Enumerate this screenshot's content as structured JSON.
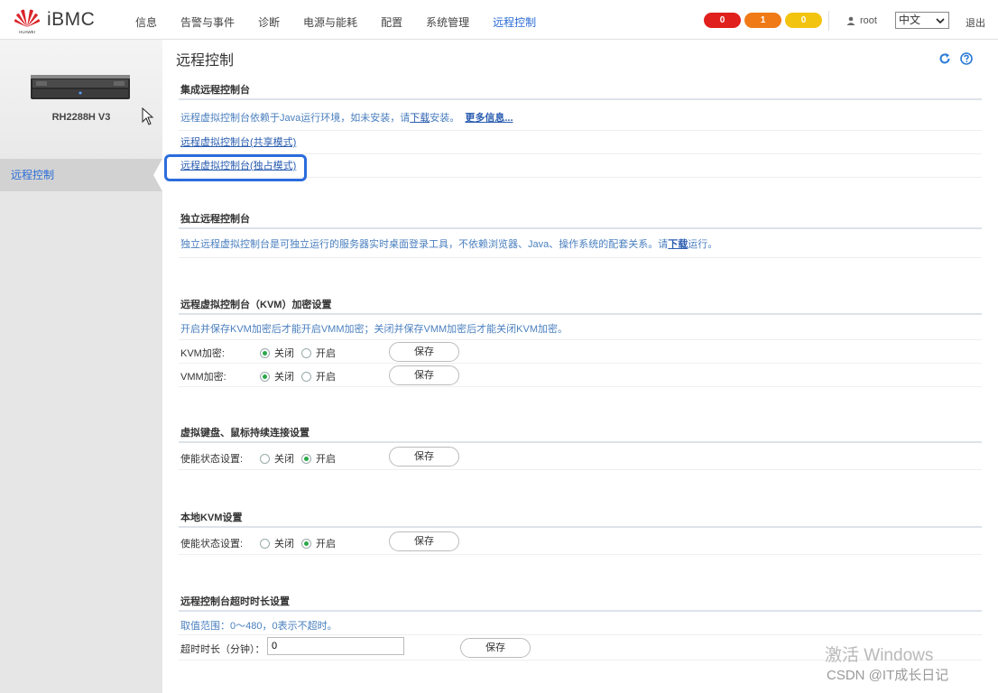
{
  "header": {
    "logo_text": "HUAWEI",
    "brand": "iBMC",
    "nav": [
      "信息",
      "告警与事件",
      "诊断",
      "电源与能耗",
      "配置",
      "系统管理",
      "远程控制"
    ],
    "active_nav": "远程控制",
    "alarms": [
      {
        "count": "0",
        "color": "#e0201d"
      },
      {
        "count": "1",
        "color": "#f07a16"
      },
      {
        "count": "0",
        "color": "#f2c40f"
      }
    ],
    "user": "root",
    "language": "中文",
    "logout": "退出"
  },
  "sidebar": {
    "model": "RH2288H V3",
    "items": [
      {
        "label": "远程控制"
      }
    ]
  },
  "page": {
    "title": "远程控制"
  },
  "integrated": {
    "heading": "集成远程控制台",
    "desc_prefix": "远程虚拟控制台依赖于Java运行环境，如未安装，请",
    "desc_link": "下载",
    "desc_suffix": "安装。",
    "more_link": "更多信息...",
    "shared_link": "远程虚拟控制台(共享模式)",
    "exclusive_link": "远程虚拟控制台(独占模式)"
  },
  "standalone": {
    "heading": "独立远程控制台",
    "desc_prefix": "独立远程虚拟控制台是可独立运行的服务器实时桌面登录工具，不依赖浏览器、Java、操作系统的配套关系。请",
    "desc_link": "下载",
    "desc_suffix": "运行。"
  },
  "kvm_encrypt": {
    "heading": "远程虚拟控制台（KVM）加密设置",
    "note": "开启并保存KVM加密后才能开启VMM加密；关闭并保存VMM加密后才能关闭KVM加密。",
    "rows": [
      {
        "label": "KVM加密:",
        "off": "关闭",
        "on": "开启",
        "selected": "off",
        "save": "保存"
      },
      {
        "label": "VMM加密:",
        "off": "关闭",
        "on": "开启",
        "selected": "off",
        "save": "保存"
      }
    ]
  },
  "persist": {
    "heading": "虚拟键盘、鼠标持续连接设置",
    "label": "使能状态设置:",
    "off": "关闭",
    "on": "开启",
    "selected": "on",
    "save": "保存"
  },
  "local_kvm": {
    "heading": "本地KVM设置",
    "label": "使能状态设置:",
    "off": "关闭",
    "on": "开启",
    "selected": "on",
    "save": "保存"
  },
  "timeout": {
    "heading": "远程控制台超时时长设置",
    "note": "取值范围：0～480，0表示不超时。",
    "label": "超时时长（分钟）：",
    "value": "0",
    "save": "保存"
  },
  "overlay": {
    "activate": "激活 Windows",
    "csdn": "CSDN @IT成长日记"
  }
}
